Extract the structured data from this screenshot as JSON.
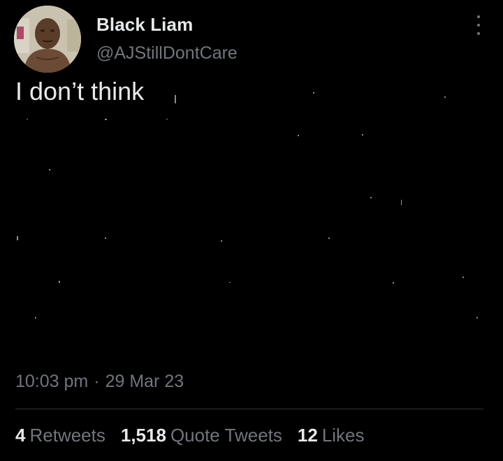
{
  "author": {
    "display_name": "Black Liam",
    "handle": "@AJStillDontCare"
  },
  "tweet": {
    "text": "I don’t think",
    "time": "10:03 pm",
    "separator": "·",
    "date": "29 Mar 23"
  },
  "stats": [
    {
      "count": "4",
      "label": "Retweets"
    },
    {
      "count": "1,518",
      "label": "Quote Tweets"
    },
    {
      "count": "12",
      "label": "Likes"
    }
  ],
  "icons": {
    "more": "more-vertical-icon"
  },
  "colors": {
    "background": "#000000",
    "primary_text": "#e7e9ea",
    "secondary_text": "#71767b",
    "divider": "#2f3336"
  }
}
